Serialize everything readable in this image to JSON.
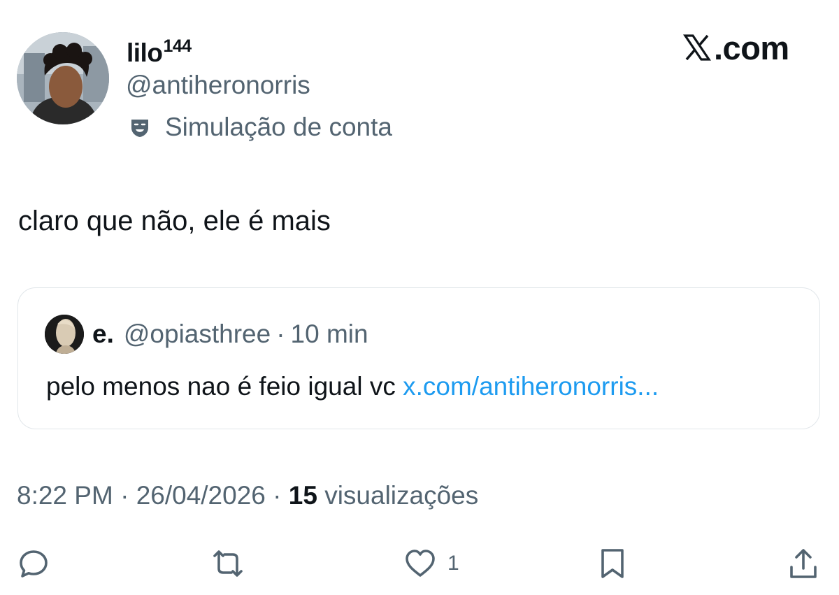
{
  "author": {
    "display_name": "lilo",
    "name_superscript": "144",
    "handle": "@antiheronorris",
    "parody_label": "Simulação de conta"
  },
  "brand": {
    "logo_text": ".com",
    "logo_icon": "x-logo-icon"
  },
  "tweet": {
    "text": "claro que não, ele é mais"
  },
  "quoted_tweet": {
    "author_name": "e.",
    "handle": "@opiasthree",
    "separator": "·",
    "time": "10 min",
    "body_text": "pelo menos nao é feio igual vc ",
    "link_text": "x.com/antiheronorris..."
  },
  "meta": {
    "time": "8:22 PM",
    "separator": "·",
    "date": "26/04/2026",
    "separator2": "·",
    "view_count": "15",
    "view_label": "visualizações"
  },
  "actions": {
    "reply_icon": "reply-icon",
    "repost_icon": "repost-icon",
    "like_icon": "heart-icon",
    "like_count": "1",
    "bookmark_icon": "bookmark-icon",
    "share_icon": "share-icon"
  },
  "colors": {
    "text_primary": "#0f1419",
    "text_secondary": "#536471",
    "link": "#1d9bf0",
    "border": "#e1e6ea"
  }
}
